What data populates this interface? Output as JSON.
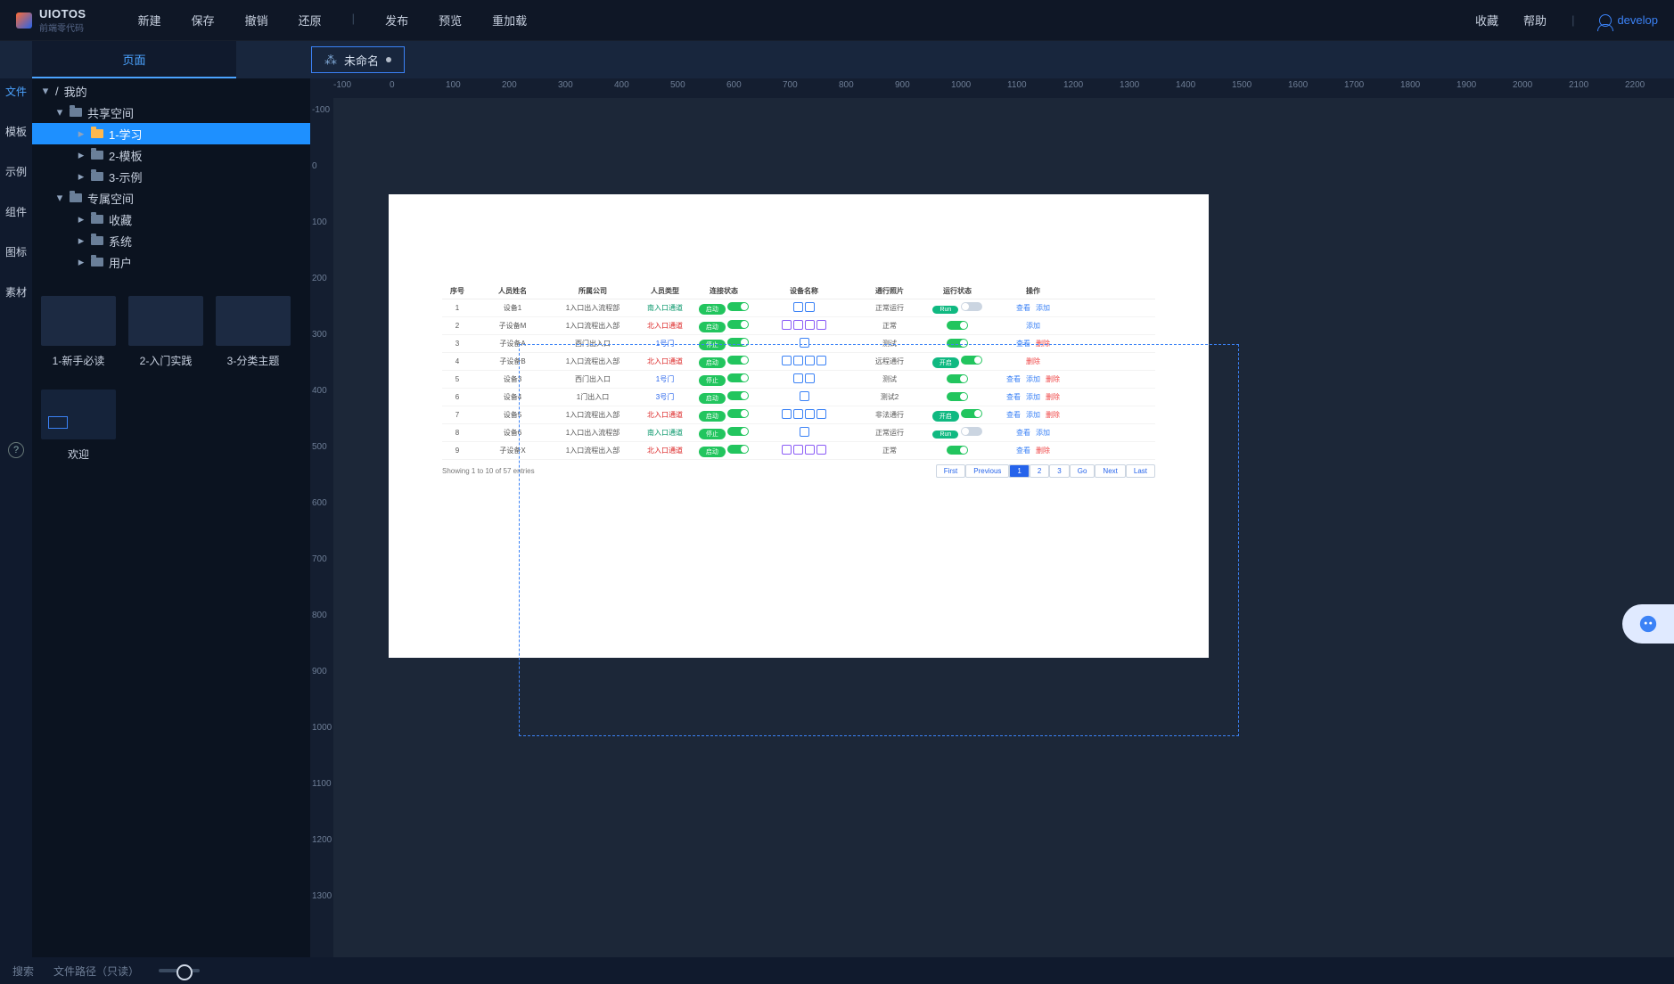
{
  "brand": {
    "name": "UIOTOS",
    "sub": "前端零代码"
  },
  "menu": {
    "new": "新建",
    "save": "保存",
    "undo": "撤销",
    "restore": "还原",
    "publish": "发布",
    "preview": "预览",
    "reload": "重加载",
    "favorite": "收藏",
    "help": "帮助",
    "user": "develop"
  },
  "tabs": {
    "page": "页面",
    "doc": "未命名"
  },
  "categories": {
    "file": "文件",
    "template": "模板",
    "example": "示例",
    "component": "组件",
    "icon": "图标",
    "material": "素材"
  },
  "tree": {
    "root": "我的",
    "shared": "共享空间",
    "shared_children": {
      "study": "1-学习",
      "tpl": "2-模板",
      "ex": "3-示例"
    },
    "private": "专属空间",
    "private_children": {
      "fav": "收藏",
      "sys": "系统",
      "user": "用户"
    }
  },
  "thumbs": {
    "a": "1-新手必读",
    "b": "2-入门实践",
    "c": "3-分类主题",
    "welcome": "欢迎"
  },
  "ruler_h": [
    "-100",
    "0",
    "100",
    "200",
    "300",
    "400",
    "500",
    "600",
    "700",
    "800",
    "900",
    "1000",
    "1100",
    "1200",
    "1300",
    "1400",
    "1500",
    "1600",
    "1700",
    "1800",
    "1900",
    "2000",
    "2100",
    "2200"
  ],
  "ruler_v": [
    "-100",
    "0",
    "100",
    "200",
    "300",
    "400",
    "500",
    "600",
    "700",
    "800",
    "900",
    "1000",
    "1100",
    "1200",
    "1300"
  ],
  "preview": {
    "heads": [
      "序号",
      "人员姓名",
      "所属公司",
      "人员类型",
      "连接状态",
      "设备名称",
      "通行照片",
      "运行状态",
      "操作"
    ],
    "rows": [
      {
        "n": "1",
        "name": "设备1",
        "dept": "1入口出入流程部",
        "type": "南入口通道",
        "type_c": "green-t",
        "conn": "启动",
        "run": "正常运行",
        "run_pill": "Run",
        "run2_grey": true,
        "ops": [
          "查看",
          "添加"
        ],
        "icons": 2,
        "iconStyle": "ico"
      },
      {
        "n": "2",
        "name": "子设备M",
        "dept": "1入口流程出入部",
        "type": "北入口通道",
        "type_c": "red-t",
        "conn": "启动",
        "run": "正常",
        "run_pill": "",
        "ops": [
          "添加"
        ],
        "icons": 4,
        "iconStyle": "ico pur"
      },
      {
        "n": "3",
        "name": "子设备A",
        "dept": "西门出入口",
        "type": "1号门",
        "type_c": "blue-t",
        "conn": "停止",
        "run": "测试",
        "run_pill": "",
        "ops": [
          "查看",
          "删除"
        ],
        "icons": 1,
        "iconStyle": "ico"
      },
      {
        "n": "4",
        "name": "子设备B",
        "dept": "1入口流程出入部",
        "type": "北入口通道",
        "type_c": "red-t",
        "conn": "启动",
        "run": "远程通行",
        "run_pill": "开启",
        "ops": [
          "删除"
        ],
        "icons": 4,
        "iconStyle": "ico"
      },
      {
        "n": "5",
        "name": "设备3",
        "dept": "西门出入口",
        "type": "1号门",
        "type_c": "blue-t",
        "conn": "停止",
        "run": "测试",
        "run_pill": "",
        "ops": [
          "查看",
          "添加",
          "删除"
        ],
        "icons": 2,
        "iconStyle": "ico"
      },
      {
        "n": "6",
        "name": "设备4",
        "dept": "1门出入口",
        "type": "3号门",
        "type_c": "blue-t",
        "conn": "启动",
        "run": "测试2",
        "run_pill": "",
        "ops": [
          "查看",
          "添加",
          "删除"
        ],
        "icons": 1,
        "iconStyle": "ico"
      },
      {
        "n": "7",
        "name": "设备5",
        "dept": "1入口流程出入部",
        "type": "北入口通道",
        "type_c": "red-t",
        "conn": "启动",
        "run": "非法通行",
        "run_pill": "开启",
        "ops": [
          "查看",
          "添加",
          "删除"
        ],
        "icons": 4,
        "iconStyle": "ico"
      },
      {
        "n": "8",
        "name": "设备6",
        "dept": "1入口出入流程部",
        "type": "南入口通道",
        "type_c": "green-t",
        "conn": "停止",
        "run": "正常运行",
        "run_pill": "Run",
        "run2_grey": true,
        "ops": [
          "查看",
          "添加"
        ],
        "icons": 1,
        "iconStyle": "ico"
      },
      {
        "n": "9",
        "name": "子设备X",
        "dept": "1入口流程出入部",
        "type": "北入口通道",
        "type_c": "red-t",
        "conn": "启动",
        "run": "正常",
        "run_pill": "",
        "ops": [
          "查看",
          "删除"
        ],
        "icons": 4,
        "iconStyle": "ico pur"
      }
    ],
    "footer_info": "Showing 1 to 10 of 57 entries",
    "pager": [
      "First",
      "Previous",
      "1",
      "2",
      "3",
      "Go",
      "Next",
      "Last"
    ]
  },
  "status": {
    "search": "搜索",
    "path_label": "文件路径（只读）"
  }
}
